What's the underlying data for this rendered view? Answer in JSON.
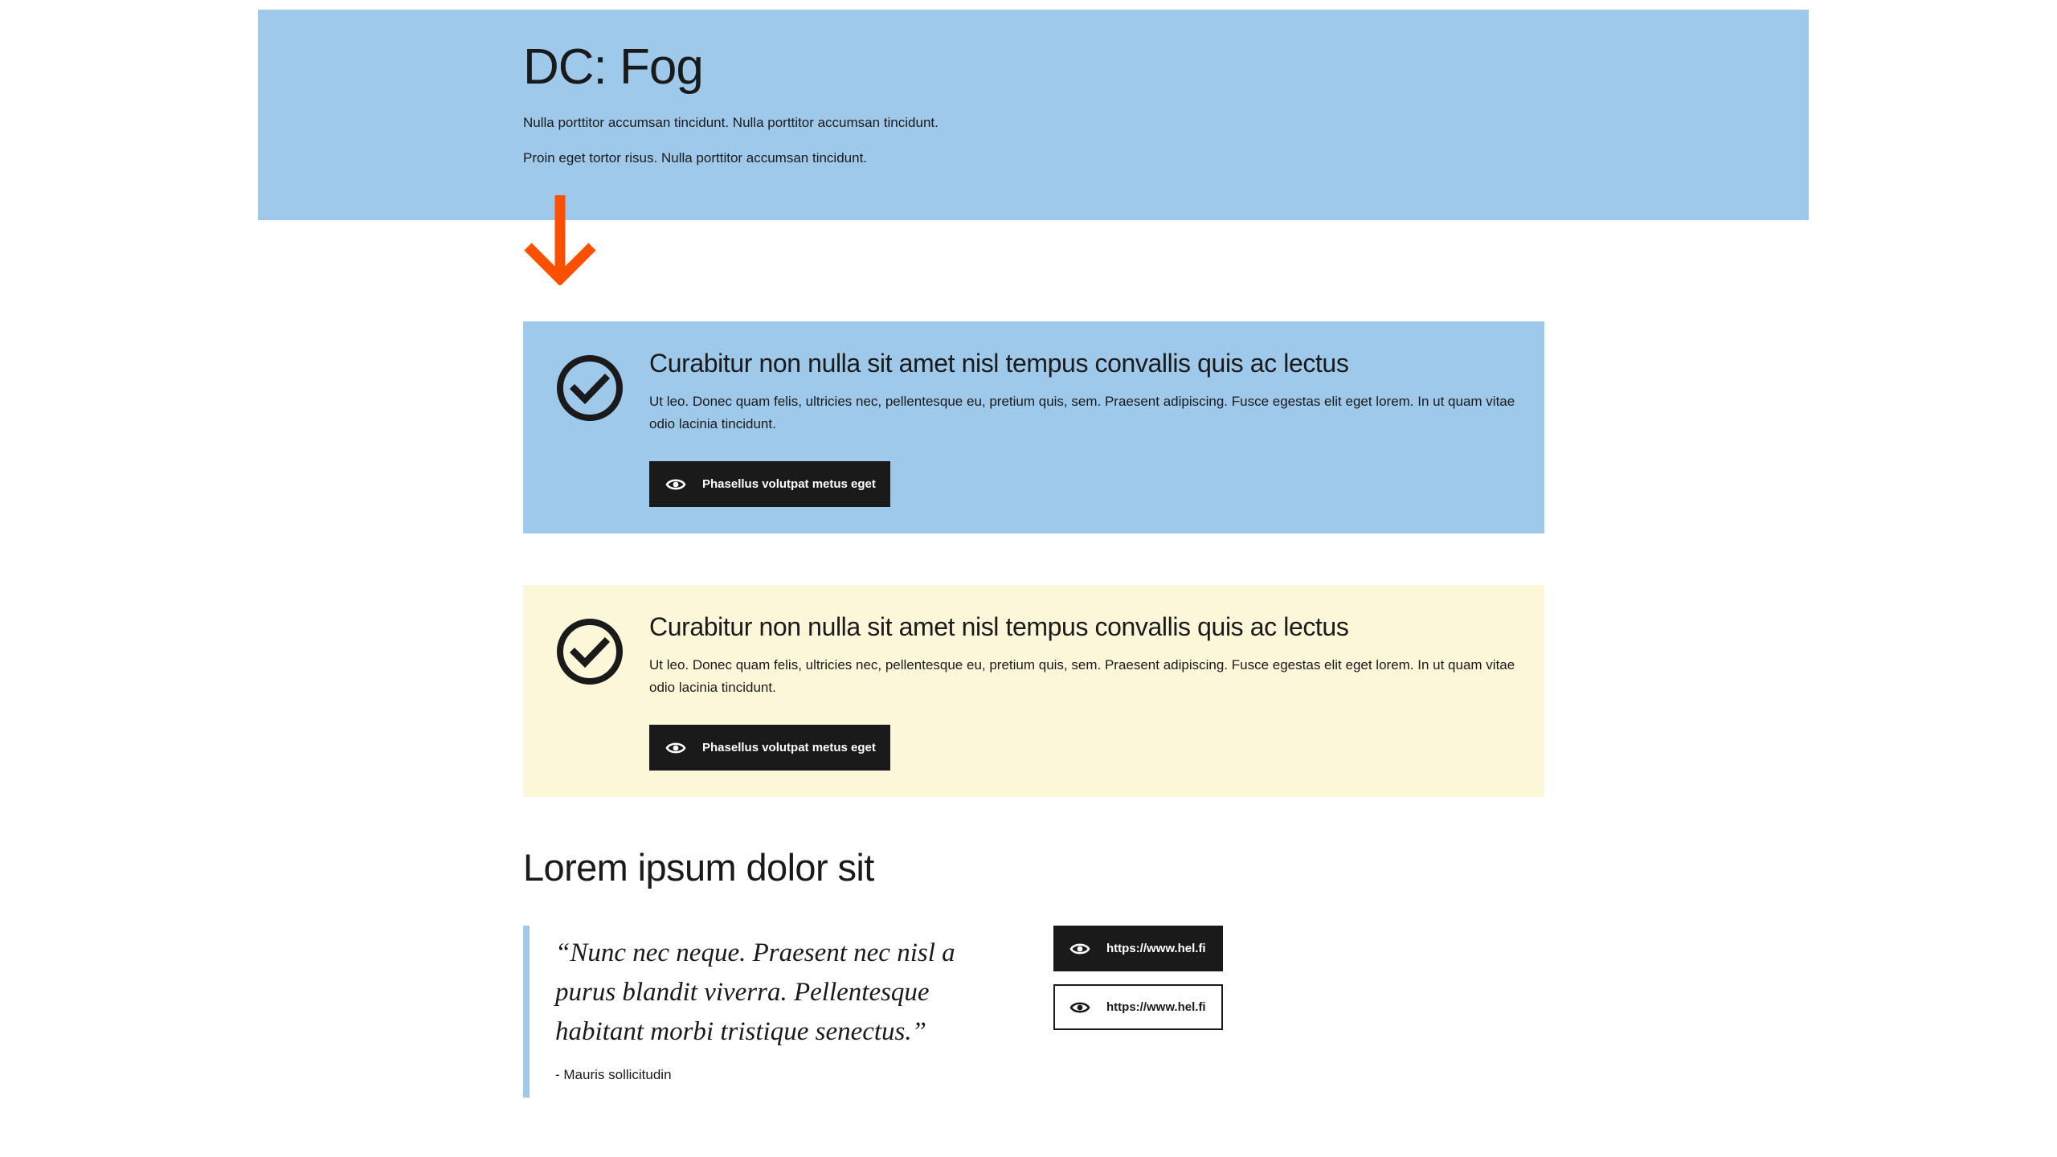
{
  "hero": {
    "title": "DC: Fog",
    "text_1": "Nulla porttitor accumsan tincidunt. Nulla porttitor accumsan tincidunt.",
    "text_2": "Proin eget tortor risus. Nulla porttitor accumsan tincidunt.",
    "background_color": "#9fc9eb",
    "arrow_color": "#fd4f00",
    "arrow_icon": "arrow-down-icon"
  },
  "cards": [
    {
      "variant": "blue",
      "background_color": "#9fc9eb",
      "icon": "check-circle-icon",
      "title": "Curabitur non nulla sit amet nisl tempus convallis quis ac lectus",
      "text": "Ut leo. Donec quam felis, ultricies nec, pellentesque eu, pretium quis, sem. Praesent adipiscing. Fusce egestas elit eget lorem. In ut quam vitae odio lacinia tincidunt.",
      "button_label": "Phasellus volutpat metus eget",
      "button_icon": "eye-icon"
    },
    {
      "variant": "yellow",
      "background_color": "#fdf7da",
      "icon": "check-circle-icon",
      "title": "Curabitur non nulla sit amet nisl tempus convallis quis ac lectus",
      "text": "Ut leo. Donec quam felis, ultricies nec, pellentesque eu, pretium quis, sem. Praesent adipiscing. Fusce egestas elit eget lorem. In ut quam vitae odio lacinia tincidunt.",
      "button_label": "Phasellus volutpat metus eget",
      "button_icon": "eye-icon"
    }
  ],
  "section": {
    "title": "Lorem ipsum dolor sit",
    "quote": "“Nunc nec neque. Praesent nec nisl a purus blandit viverra. Pellentesque habitant morbi tristique senectus.”",
    "author": "- Mauris sollicitudin",
    "links": [
      {
        "label": "https://www.hel.fi",
        "style": "filled",
        "icon": "eye-icon"
      },
      {
        "label": "https://www.hel.fi",
        "style": "outline",
        "icon": "eye-icon"
      }
    ]
  }
}
